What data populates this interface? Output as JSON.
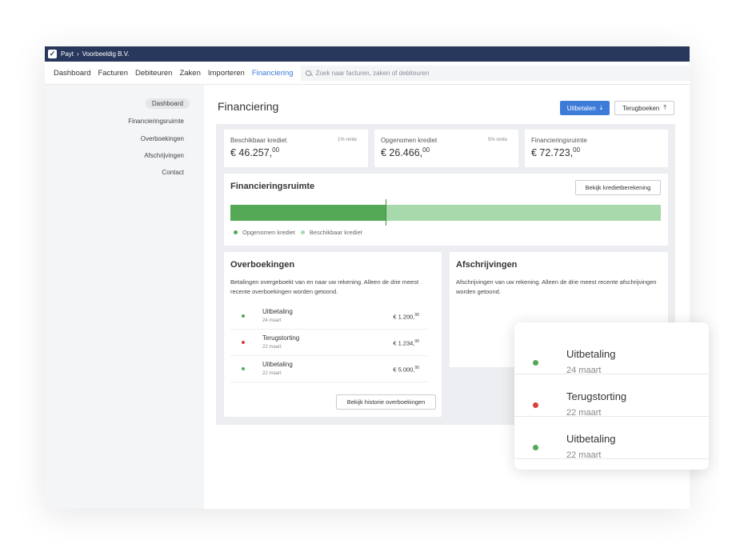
{
  "topbar": {
    "app_name": "Payt",
    "separator": "›",
    "company": "Voorbeeldig B.V."
  },
  "nav": {
    "items": [
      "Dashboard",
      "Facturen",
      "Debiteuren",
      "Zaken",
      "Importeren",
      "Financiering"
    ],
    "active": "Financiering",
    "search_placeholder": "Zoek naar facturen, zaken of debiteuren"
  },
  "sidebar": {
    "items": [
      "Dashboard",
      "Financieringsruimte",
      "Overboekingen",
      "Afschrijvingen",
      "Contact"
    ],
    "active": "Dashboard"
  },
  "page": {
    "title": "Financiering",
    "primary_button": "Uitbetalen",
    "secondary_button": "Terugboeken"
  },
  "stats": [
    {
      "label": "Beschikbaar krediet",
      "rate": "1% rente",
      "value_main": "€ 46.257,",
      "value_cents": "00"
    },
    {
      "label": "Opgenomen krediet",
      "rate": "5% rente",
      "value_main": "€ 26.466,",
      "value_cents": "00"
    },
    {
      "label": "Financieringsruimte",
      "rate": "",
      "value_main": "€ 72.723,",
      "value_cents": "00"
    }
  ],
  "financing": {
    "title": "Financieringsruimte",
    "button": "Bekijk kredietberekening",
    "used_fraction": 0.36,
    "legend": [
      "Opgenomen krediet",
      "Beschikbaar krediet"
    ]
  },
  "colors": {
    "green": "#53a956",
    "light_green": "#a8d9ad",
    "red": "#d9403a",
    "accent": "#3d7bd9",
    "topbar": "#28385c"
  },
  "transfers": {
    "title": "Overboekingen",
    "description": "Betalingen overgeboekt van en naar uw rekening. Alleen de drie meest recente overboekingen worden getoond.",
    "rows": [
      {
        "name": "Uitbetaling",
        "date": "24 maart",
        "amount_main": "€ 1.200,",
        "amount_cents": "00",
        "status": "green"
      },
      {
        "name": "Terugstorting",
        "date": "22 maart",
        "amount_main": "€ 1.234,",
        "amount_cents": "00",
        "status": "red"
      },
      {
        "name": "Uitbetaling",
        "date": "22 maart",
        "amount_main": "€ 5.000,",
        "amount_cents": "00",
        "status": "green"
      }
    ],
    "button": "Bekijk historie overboekingen"
  },
  "writeoffs": {
    "title": "Afschrijvingen",
    "description": "Afschrijvingen van uw rekening. Alleen de drie meest recente afschrijvingen worden getoond."
  },
  "popover": {
    "rows": [
      {
        "name": "Uitbetaling",
        "date": "24 maart",
        "status": "green"
      },
      {
        "name": "Terugstorting",
        "date": "22 maart",
        "status": "red"
      },
      {
        "name": "Uitbetaling",
        "date": "22 maart",
        "status": "green"
      }
    ]
  }
}
